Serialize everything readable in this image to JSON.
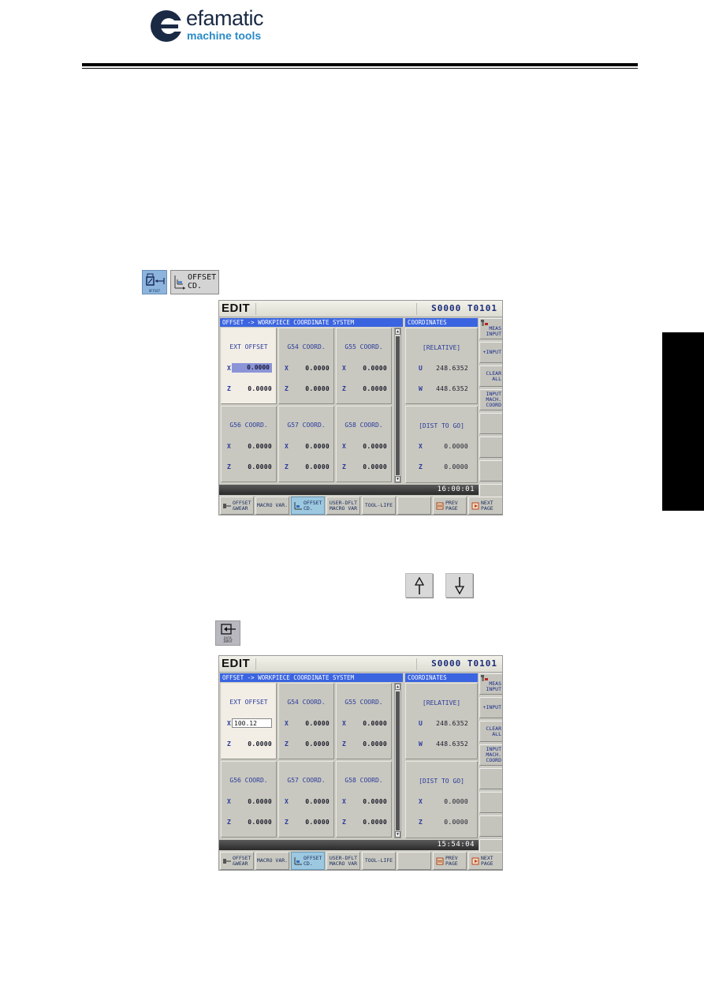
{
  "brand": {
    "name": "efamatic",
    "tagline": "machine tools",
    "colors": {
      "name": "#1a2a44",
      "tagline": "#2a8ac8"
    }
  },
  "keys": {
    "offset_key": {
      "icon": "offset-tool-icon",
      "label": "OFFSET"
    },
    "offset_cd_softkey": {
      "icon": "coordinate-axes-icon",
      "label": "OFFSET\nCD."
    },
    "cursor_up": {
      "icon": "arrow-up-icon"
    },
    "cursor_down": {
      "icon": "arrow-down-icon"
    },
    "data_input": {
      "icon": "data-input-icon",
      "label": "DATA\nINPUT"
    }
  },
  "screens": [
    {
      "mode": "EDIT",
      "spindle_tool": "S0000 T0101",
      "left_title": "OFFSET -> WORKPIECE COORDINATE SYSTEM",
      "right_title": "COORDINATES",
      "cells": [
        {
          "title": "EXT OFFSET",
          "x_label": "X",
          "x": "0.0000",
          "z_label": "Z",
          "z": "0.0000",
          "state": "highlighted"
        },
        {
          "title": "G54 COORD.",
          "x_label": "X",
          "x": "0.0000",
          "z_label": "Z",
          "z": "0.0000"
        },
        {
          "title": "G55 COORD.",
          "x_label": "X",
          "x": "0.0000",
          "z_label": "Z",
          "z": "0.0000"
        },
        {
          "title": "G56 COORD.",
          "x_label": "X",
          "x": "0.0000",
          "z_label": "Z",
          "z": "0.0000"
        },
        {
          "title": "G57 COORD.",
          "x_label": "X",
          "x": "0.0000",
          "z_label": "Z",
          "z": "0.0000"
        },
        {
          "title": "G58 COORD.",
          "x_label": "X",
          "x": "0.0000",
          "z_label": "Z",
          "z": "0.0000"
        }
      ],
      "relative": {
        "title": "[RELATIVE]",
        "u_label": "U",
        "u": "248.6352",
        "w_label": "W",
        "w": "448.6352"
      },
      "dist_to_go": {
        "title": "[DIST TO GO]",
        "x_label": "X",
        "x": "0.0000",
        "z_label": "Z",
        "z": "0.0000"
      },
      "clock": "16:00:01",
      "side_softkeys": [
        "MEAS\nINPUT",
        "+INPUT",
        "CLEAR\nALL",
        "INPUT\nMACH.\nCOORD",
        "",
        "",
        "",
        ""
      ],
      "bottom_softkeys": [
        "OFFSET\n&WEAR",
        "MACRO VAR.",
        "OFFSET\nCD.",
        "USER-DFLT\nMACRO VAR",
        "TOOL-LIFE",
        "",
        "PREV\nPAGE",
        "NEXT\nPAGE"
      ],
      "active_bottom_softkey": "OFFSET CD."
    },
    {
      "mode": "EDIT",
      "spindle_tool": "S0000 T0101",
      "left_title": "OFFSET -> WORKPIECE COORDINATE SYSTEM",
      "right_title": "COORDINATES",
      "cells": [
        {
          "title": "EXT OFFSET",
          "x_label": "X",
          "x": "100.12",
          "z_label": "Z",
          "z": "0.0000",
          "state": "editing"
        },
        {
          "title": "G54 COORD.",
          "x_label": "X",
          "x": "0.0000",
          "z_label": "Z",
          "z": "0.0000"
        },
        {
          "title": "G55 COORD.",
          "x_label": "X",
          "x": "0.0000",
          "z_label": "Z",
          "z": "0.0000"
        },
        {
          "title": "G56 COORD.",
          "x_label": "X",
          "x": "0.0000",
          "z_label": "Z",
          "z": "0.0000"
        },
        {
          "title": "G57 COORD.",
          "x_label": "X",
          "x": "0.0000",
          "z_label": "Z",
          "z": "0.0000"
        },
        {
          "title": "G58 COORD.",
          "x_label": "X",
          "x": "0.0000",
          "z_label": "Z",
          "z": "0.0000"
        }
      ],
      "relative": {
        "title": "[RELATIVE]",
        "u_label": "U",
        "u": "248.6352",
        "w_label": "W",
        "w": "448.6352"
      },
      "dist_to_go": {
        "title": "[DIST TO GO]",
        "x_label": "X",
        "x": "0.0000",
        "z_label": "Z",
        "z": "0.0000"
      },
      "clock": "15:54:04",
      "side_softkeys": [
        "MEAS\nINPUT",
        "+INPUT",
        "CLEAR\nALL",
        "INPUT\nMACH.\nCOORD",
        "",
        "",
        "",
        ""
      ],
      "bottom_softkeys": [
        "OFFSET\n&WEAR",
        "MACRO VAR.",
        "OFFSET\nCD.",
        "USER-DFLT\nMACRO VAR",
        "TOOL-LIFE",
        "",
        "PREV\nPAGE",
        "NEXT\nPAGE"
      ],
      "active_bottom_softkey": "OFFSET CD."
    }
  ]
}
